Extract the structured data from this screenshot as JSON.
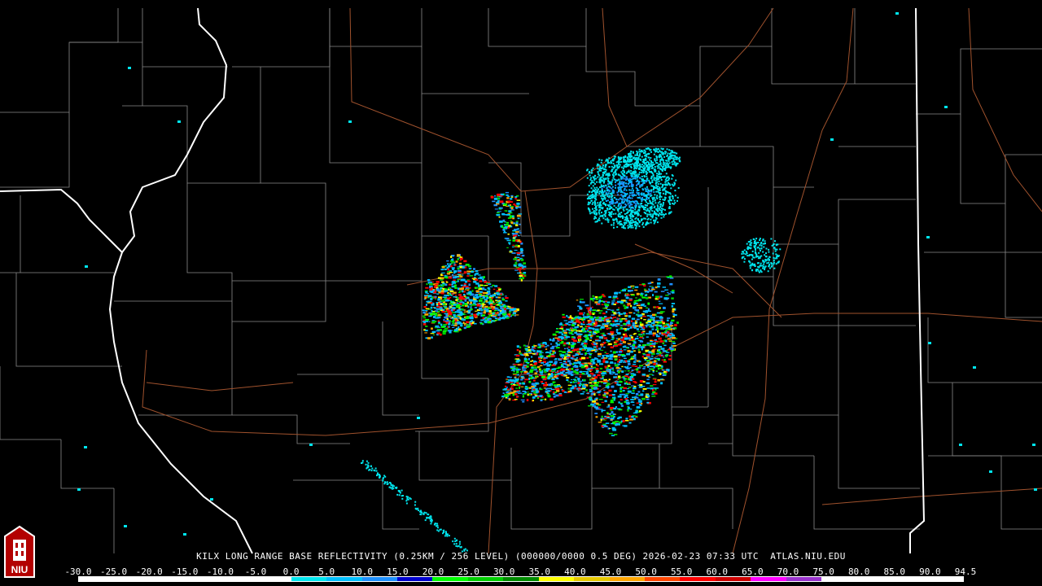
{
  "title": "KILX LONG RANGE BASE REFLECTIVITY (0.25KM / 256 LEVEL) (000000/0000 0.5 DEG) 2026-02-23 07:33 UTC  ATLAS.NIU.EDU",
  "logo_text": "NIU",
  "colors": {
    "background": "#000000",
    "county_lines": "#8a8a8a",
    "state_lines": "#ffffff",
    "roads": "#a0522d"
  },
  "scale": {
    "labels": [
      "-30.0",
      "-25.0",
      "-20.0",
      "-15.0",
      "-10.0",
      "-5.0",
      "0.0",
      "5.0",
      "10.0",
      "15.0",
      "20.0",
      "25.0",
      "30.0",
      "35.0",
      "40.0",
      "45.0",
      "50.0",
      "55.0",
      "60.0",
      "65.0",
      "70.0",
      "75.0",
      "80.0",
      "85.0",
      "90.0",
      "94.5"
    ],
    "colors": [
      "#ffffff",
      "#ffffff",
      "#ffffff",
      "#ffffff",
      "#ffffff",
      "#ffffff",
      "#00e5ee",
      "#00bfff",
      "#1e90ff",
      "#0000cd",
      "#00ff00",
      "#00cd00",
      "#008b00",
      "#ffff00",
      "#e6c800",
      "#ffa500",
      "#ff4500",
      "#ff0000",
      "#cd0000",
      "#ff00ff",
      "#9932cc",
      "#ffffff",
      "#ffffff",
      "#ffffff",
      "#ffffff"
    ]
  }
}
